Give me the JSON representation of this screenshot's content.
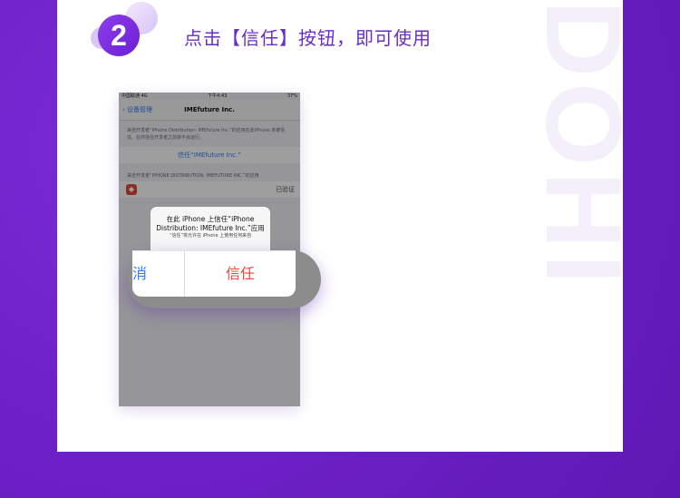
{
  "step": {
    "number": "2",
    "instruction": "点击【信任】按钮，即可使用"
  },
  "watermark": "DOHI",
  "phone": {
    "status_left": "中国联通  4G",
    "status_time": "下午4:43",
    "status_right": "37%",
    "nav_back": "设备管理",
    "nav_title": "IMEfuture Inc.",
    "description": "来自开发者“iPhone Distribution: IMEfuture Inc.”的应用在此iPhone 未被信任。在你信任开发者之前将不会运行。",
    "trust_row": "信任“IMEfuture Inc.”",
    "apps_header": "来自开发者“IPHONE DISTRIBUTION: IMEFUTURE INC.”的应用",
    "app_status": "已验证"
  },
  "alert": {
    "title": "在此 iPhone 上信任“iPhone Distribution: IMEfuture Inc.”应用",
    "message": "“信任”将允许在 iPhone 上使用任何来自"
  },
  "zoom": {
    "cancel_label": "消",
    "trust_label": "信任"
  },
  "colors": {
    "background": "#6f22c9",
    "accent": "#6a1fd0",
    "trust_red": "#f0483a",
    "ios_blue": "#2f7cf6"
  }
}
